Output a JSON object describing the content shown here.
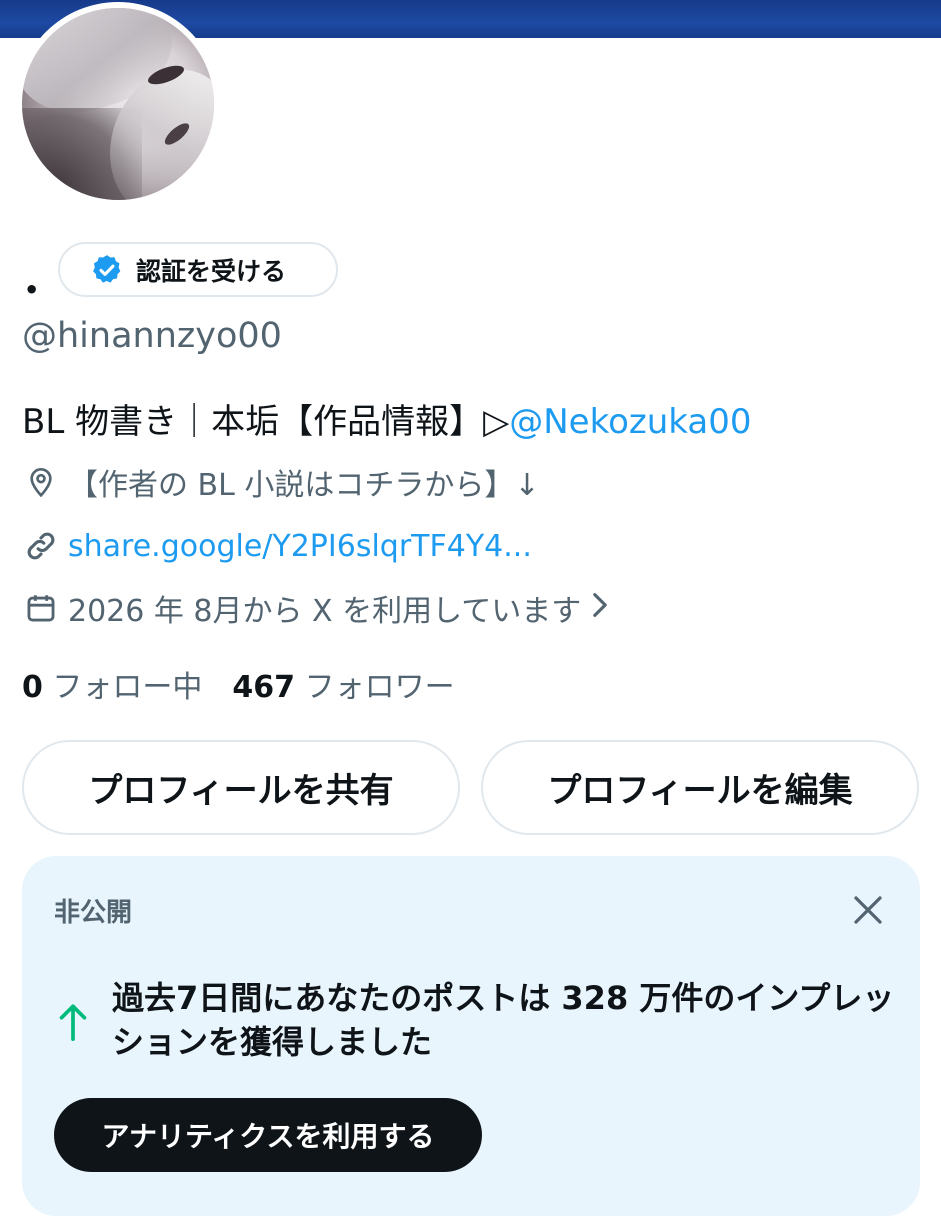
{
  "profile": {
    "display_name": "•",
    "verify_label": "認証を受ける",
    "handle": "@hinannzyo00",
    "bio_text": "BL 物書き｜本垢【作品情報】▷",
    "bio_mention": "@Nekozuka00",
    "location": "【作者の BL 小説はコチラから】↓",
    "website": "share.google/Y2PI6slqrTF4Y4...",
    "joined": "2026 年 8月から X を利用しています",
    "following_count": "0",
    "following_label": "フォロー中",
    "followers_count": "467",
    "followers_label": "フォロワー"
  },
  "actions": {
    "share_label": "プロフィールを共有",
    "edit_label": "プロフィールを編集"
  },
  "insight_card": {
    "tag": "非公開",
    "message": "過去7日間にあなたのポストは 328 万件のインプレッションを獲得しました",
    "button_label": "アナリティクスを利用する"
  },
  "colors": {
    "banner": "#1e4aa3",
    "link": "#1d9bf0",
    "card_bg": "#e8f5fd",
    "trend_up": "#00ba7c"
  },
  "icons": [
    "verified-badge-icon",
    "location-pin-icon",
    "link-icon",
    "calendar-icon",
    "chevron-right-icon",
    "close-icon",
    "arrow-up-icon"
  ]
}
